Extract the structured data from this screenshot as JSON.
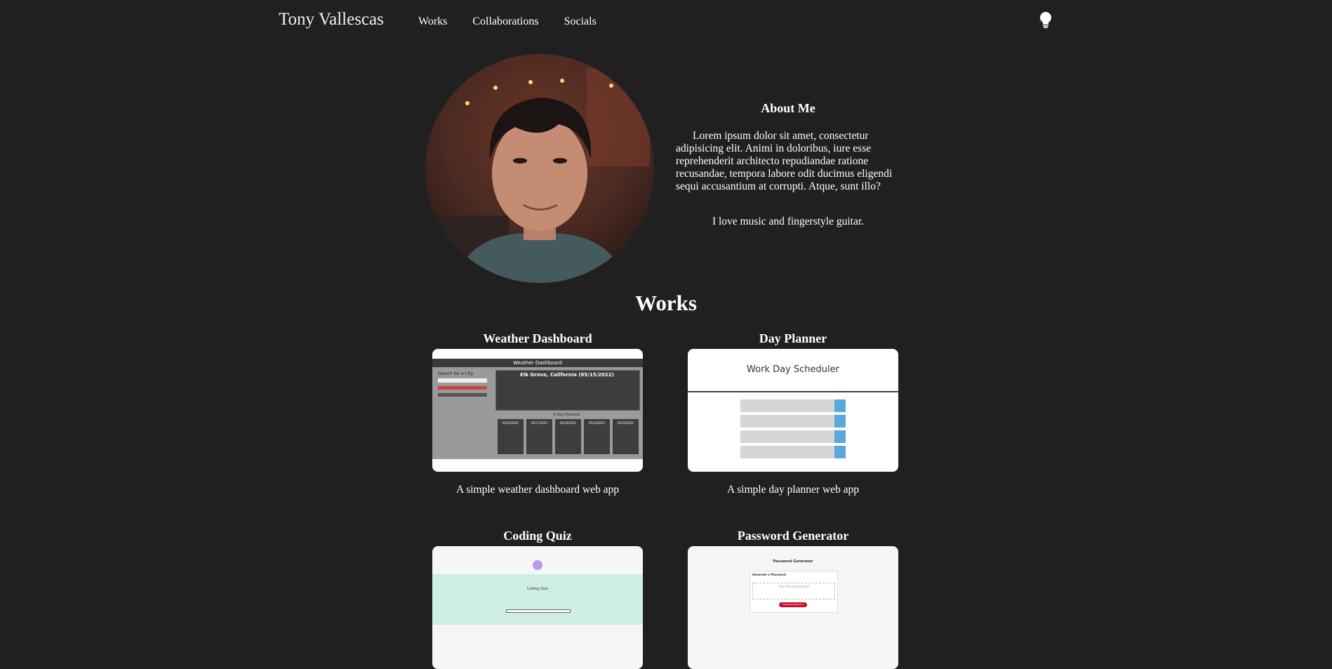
{
  "header": {
    "brand": "Tony Vallescas",
    "nav": [
      "Works",
      "Collaborations",
      "Socials"
    ],
    "theme_icon": "lightbulb-icon"
  },
  "about": {
    "title": "About Me",
    "text": "Lorem ipsum dolor sit amet, consectetur adipisicing elit. Animi in doloribus, iure esse reprehenderit architecto repudiandae ratione recusandae, tempora labore odit ducimus eligendi sequi accusantium at corrupti. Atque, sunt illo?",
    "hobby": "I love music and fingerstyle guitar."
  },
  "works": {
    "title": "Works",
    "projects": [
      {
        "title": "Weather Dashboard",
        "description": "A simple weather dashboard web app",
        "preview": {
          "header": "Weather Dashboard",
          "sidebar_title": "Search for a City:",
          "city": "Elk Grove, California (05/15/2022)",
          "forecast_title": "5-Day Forecast:",
          "days": [
            "05/16/2022",
            "05/17/2022",
            "05/18/2022",
            "05/19/2022",
            "05/20/2022"
          ]
        }
      },
      {
        "title": "Day Planner",
        "description": "A simple day planner web app",
        "preview": {
          "header": "Work Day Scheduler"
        }
      },
      {
        "title": "Coding Quiz",
        "description": "",
        "preview": {
          "heading": "Coding Quiz"
        }
      },
      {
        "title": "Password Generator",
        "description": "",
        "preview": {
          "header": "Password Generator",
          "subheader": "Generate a Password",
          "placeholder": "Your Secure Password",
          "button": "Generate Password"
        }
      }
    ]
  },
  "colors": {
    "background": "#202020",
    "text": "#ffffff",
    "quiz_band": "#ceeee6",
    "quiz_accent": "#b89be8",
    "password_button": "#c8102e"
  }
}
